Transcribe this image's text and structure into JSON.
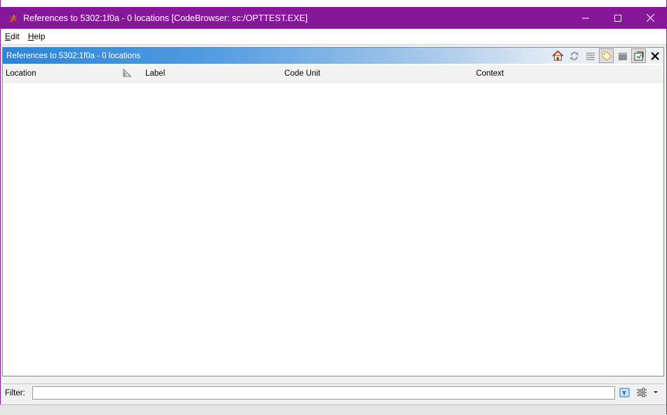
{
  "window": {
    "title": "References to 5302:1f0a - 0 locations [CodeBrowser: sc:/OPTTEST.EXE]",
    "app_icon": "ghidra-dragon-icon",
    "controls": [
      "minimize-icon",
      "maximize-icon",
      "close-icon"
    ],
    "accent": "#87179a"
  },
  "menubar": {
    "items": [
      {
        "label": "Edit",
        "mnemonic": "E",
        "rest": "dit"
      },
      {
        "label": "Help",
        "mnemonic": "H",
        "rest": "elp"
      }
    ]
  },
  "panel": {
    "title": "References to 5302:1f0a - 0 locations",
    "tools": [
      "home-icon",
      "refresh-icon",
      "list-icon",
      "tag-icon",
      "block-icon",
      "snapshot-icon",
      "close-icon"
    ]
  },
  "table": {
    "columns": [
      "Location",
      "Label",
      "Code Unit",
      "Context"
    ],
    "rows": []
  },
  "filter": {
    "label": "Filter:",
    "value": ""
  }
}
